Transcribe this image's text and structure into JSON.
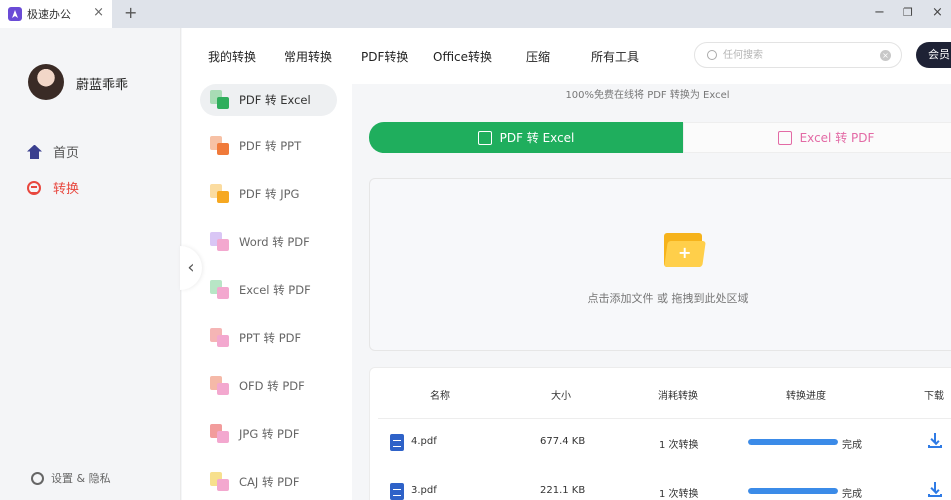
{
  "window": {
    "tab_title": "极速办公",
    "tab_close": "×",
    "new_tab": "+",
    "minimize": "−",
    "restore": "❐",
    "close": "×"
  },
  "user": {
    "name": "蔚蓝乖乖"
  },
  "nav": {
    "home": "首页",
    "convert": "转换",
    "settings": "设置 & 隐私"
  },
  "menu": {
    "items": [
      "我的转换",
      "常用转换",
      "PDF转换",
      "Office转换",
      "压缩",
      "所有工具"
    ],
    "search_placeholder": "任何搜索",
    "vip": "会员"
  },
  "tools": [
    {
      "label": "PDF 转 Excel",
      "color_a": "#a8dcb5",
      "color_b": "#2fae5c",
      "active": true
    },
    {
      "label": "PDF 转 PPT",
      "color_a": "#f7c1a5",
      "color_b": "#f07a3a",
      "active": false
    },
    {
      "label": "PDF 转 JPG",
      "color_a": "#fbdca0",
      "color_b": "#f6a821",
      "active": false
    },
    {
      "label": "Word 转 PDF",
      "color_a": "#d9c6f5",
      "color_b": "#f3a8cf",
      "active": false
    },
    {
      "label": "Excel 转 PDF",
      "color_a": "#b8e6c6",
      "color_b": "#f3a8cf",
      "active": false
    },
    {
      "label": "PPT 转 PDF",
      "color_a": "#f5b5b5",
      "color_b": "#f3a8cf",
      "active": false
    },
    {
      "label": "OFD 转 PDF",
      "color_a": "#f5b9a8",
      "color_b": "#f3a8cf",
      "active": false
    },
    {
      "label": "JPG 转 PDF",
      "color_a": "#f29c9c",
      "color_b": "#f3a8cf",
      "active": false
    },
    {
      "label": "CAJ 转 PDF",
      "color_a": "#f7e08e",
      "color_b": "#f3a8cf",
      "active": false
    }
  ],
  "main": {
    "subtitle": "100%免费在线将 PDF 转换为 Excel",
    "mode_active": "PDF 转 Excel",
    "mode_inactive": "Excel 转 PDF",
    "drop_text": "点击添加文件 或 拖拽到此处区域"
  },
  "table": {
    "headers": [
      "名称",
      "大小",
      "消耗转换",
      "转换进度",
      "下载"
    ],
    "rows": [
      {
        "name": "4.pdf",
        "size": "677.4 KB",
        "cost": "1 次转换",
        "progress": 1.0,
        "status": "完成"
      },
      {
        "name": "3.pdf",
        "size": "221.1 KB",
        "cost": "1 次转换",
        "progress": 1.0,
        "status": "完成"
      }
    ]
  }
}
